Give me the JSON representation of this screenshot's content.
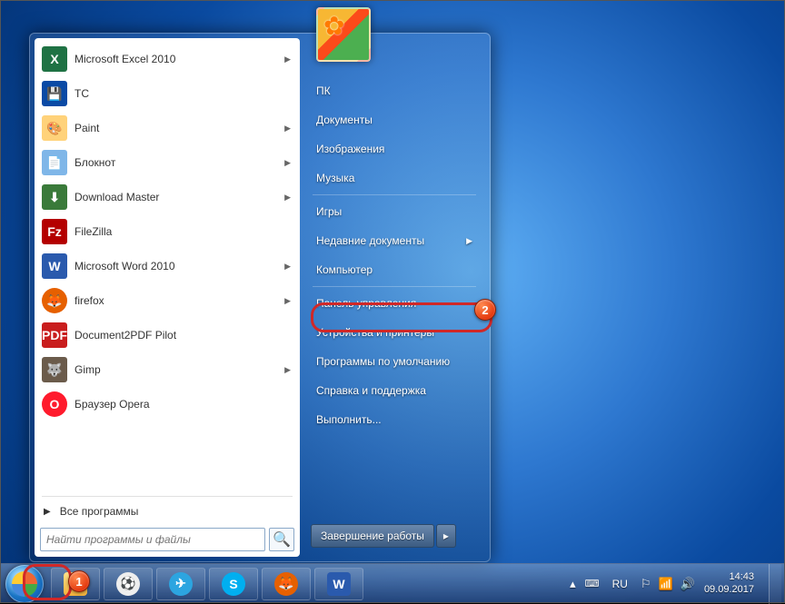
{
  "programs": [
    {
      "label": "Microsoft Excel 2010",
      "icon": "excel",
      "iconText": "X",
      "hasSub": true
    },
    {
      "label": "TC",
      "icon": "tc",
      "iconText": "💾",
      "hasSub": false
    },
    {
      "label": "Paint",
      "icon": "paint",
      "iconText": "🎨",
      "hasSub": true
    },
    {
      "label": "Блокнот",
      "icon": "note",
      "iconText": "📄",
      "hasSub": true
    },
    {
      "label": "Download Master",
      "icon": "dm",
      "iconText": "⬇",
      "hasSub": true
    },
    {
      "label": "FileZilla",
      "icon": "fz",
      "iconText": "Fz",
      "hasSub": false
    },
    {
      "label": "Microsoft Word 2010",
      "icon": "word",
      "iconText": "W",
      "hasSub": true
    },
    {
      "label": "firefox",
      "icon": "ff",
      "iconText": "🦊",
      "hasSub": true
    },
    {
      "label": "Document2PDF Pilot",
      "icon": "pdf",
      "iconText": "PDF",
      "hasSub": false
    },
    {
      "label": "Gimp",
      "icon": "gimp",
      "iconText": "🐺",
      "hasSub": true
    },
    {
      "label": "Браузер Opera",
      "icon": "opera",
      "iconText": "O",
      "hasSub": false
    }
  ],
  "all_programs_label": "Все программы",
  "search_placeholder": "Найти программы и файлы",
  "right_items": [
    {
      "label": "ПК",
      "hasSub": false
    },
    {
      "label": "Документы",
      "hasSub": false
    },
    {
      "label": "Изображения",
      "hasSub": false
    },
    {
      "label": "Музыка",
      "hasSub": false
    },
    {
      "divider": true
    },
    {
      "label": "Игры",
      "hasSub": false
    },
    {
      "label": "Недавние документы",
      "hasSub": true
    },
    {
      "label": "Компьютер",
      "hasSub": false
    },
    {
      "divider": true
    },
    {
      "label": "Панель управления",
      "hasSub": false
    },
    {
      "label": "Устройства и принтеры",
      "hasSub": false
    },
    {
      "label": "Программы по умолчанию",
      "hasSub": false
    },
    {
      "label": "Справка и поддержка",
      "hasSub": false
    },
    {
      "label": "Выполнить...",
      "hasSub": false
    }
  ],
  "shutdown_label": "Завершение работы",
  "taskbar_buttons": [
    {
      "name": "file-manager",
      "icon": "folders",
      "text": "▣"
    },
    {
      "name": "soccer-app",
      "icon": "soccer",
      "text": "⚽"
    },
    {
      "name": "telegram",
      "icon": "telegram",
      "text": "✈"
    },
    {
      "name": "skype",
      "icon": "skype",
      "text": "S"
    },
    {
      "name": "firefox",
      "icon": "ff",
      "text": "🦊"
    },
    {
      "name": "word",
      "icon": "wordtb",
      "text": "W"
    }
  ],
  "systray": {
    "lang": "RU",
    "time": "14:43",
    "date": "09.09.2017"
  },
  "annotations": {
    "badge1": "1",
    "badge2": "2"
  }
}
